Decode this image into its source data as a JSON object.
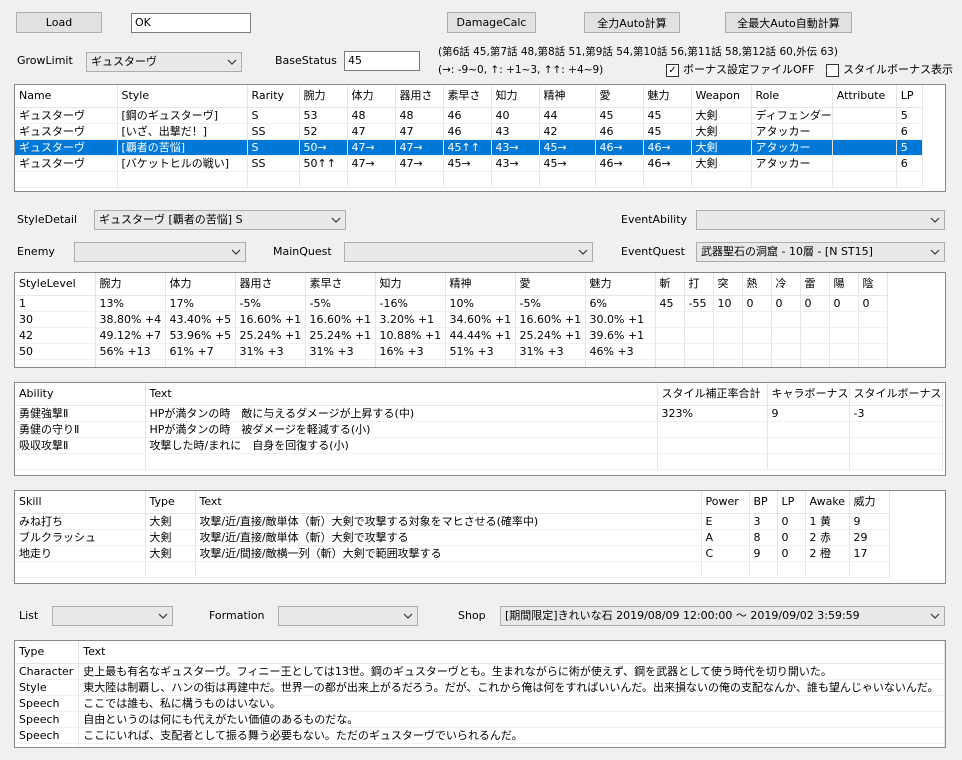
{
  "toolbar": {
    "load_label": "Load",
    "load_value": "OK",
    "damage_calc_label": "DamageCalc",
    "full_auto_label": "全力Auto計算",
    "max_auto_label": "全最大Auto自動計算"
  },
  "grow": {
    "label": "GrowLimit",
    "value": "ギュスターヴ",
    "base_status_label": "BaseStatus",
    "base_status_value": "45",
    "info_line1": "(第6話 45,第7話 48,第8話 51,第9話 54,第10話 56,第11話 58,第12話 60,外伝 63)",
    "info_line2": "(→: -9~0, ↑: +1~3, ↑↑: +4~9)",
    "bonus_file_off_label": "ボーナス設定ファイルOFF",
    "bonus_file_off_checked": "✓",
    "style_bonus_label": "スタイルボーナス表示",
    "style_bonus_checked": ""
  },
  "styles_table": {
    "headers": [
      "Name",
      "Style",
      "Rarity",
      "腕力",
      "体力",
      "器用さ",
      "素早さ",
      "知力",
      "精神",
      "愛",
      "魅力",
      "Weapon",
      "Role",
      "Attribute",
      "LP"
    ],
    "rows": [
      [
        "ギュスターヴ",
        "[鋼のギュスターヴ]",
        "S",
        "53",
        "48",
        "48",
        "46",
        "40",
        "44",
        "45",
        "45",
        "大剣",
        "ディフェンダー",
        "",
        "5"
      ],
      [
        "ギュスターヴ",
        "[いざ、出撃だ！]",
        "SS",
        "52",
        "47",
        "47",
        "46",
        "43",
        "42",
        "46",
        "45",
        "大剣",
        "アタッカー",
        "",
        "6"
      ],
      [
        "ギュスターヴ",
        "[覇者の苦悩]",
        "S",
        "50→",
        "47→",
        "47→",
        "45↑↑",
        "43→",
        "45→",
        "46→",
        "46→",
        "大剣",
        "アタッカー",
        "",
        "5"
      ],
      [
        "ギュスターヴ",
        "[バケットヒルの戦い]",
        "SS",
        "50↑↑",
        "47→",
        "47→",
        "45→",
        "43→",
        "45→",
        "46→",
        "46→",
        "大剣",
        "アタッカー",
        "",
        "6"
      ]
    ],
    "selected_row": 2
  },
  "filters": {
    "style_detail_label": "StyleDetail",
    "style_detail_value": "ギュスターヴ [覇者の苦悩] S",
    "event_ability_label": "EventAbility",
    "event_ability_value": "",
    "enemy_label": "Enemy",
    "enemy_value": "",
    "main_quest_label": "MainQuest",
    "main_quest_value": "",
    "event_quest_label": "EventQuest",
    "event_quest_value": "武器聖石の洞窟 - 10層 - [N ST15]"
  },
  "level_table": {
    "headers": [
      "StyleLevel",
      "腕力",
      "体力",
      "器用さ",
      "素早さ",
      "知力",
      "精神",
      "愛",
      "魅力",
      "斬",
      "打",
      "突",
      "熱",
      "冷",
      "雷",
      "陽",
      "陰"
    ],
    "rows": [
      [
        "1",
        "13%",
        "17%",
        "-5%",
        "-5%",
        "-16%",
        "10%",
        "-5%",
        "6%",
        "45",
        "-55",
        "10",
        "0",
        "0",
        "0",
        "0",
        "0"
      ],
      [
        "30",
        "38.80% +4",
        "43.40% +5",
        "16.60% +1",
        "16.60% +1",
        "3.20% +1",
        "34.60% +1",
        "16.60% +1",
        "30.0% +1",
        "",
        "",
        "",
        "",
        "",
        "",
        "",
        ""
      ],
      [
        "42",
        "49.12% +7",
        "53.96% +5",
        "25.24% +1",
        "25.24% +1",
        "10.88% +1",
        "44.44% +1",
        "25.24% +1",
        "39.6% +1",
        "",
        "",
        "",
        "",
        "",
        "",
        "",
        ""
      ],
      [
        "50",
        "56% +13",
        "61% +7",
        "31% +3",
        "31% +3",
        "16% +3",
        "51% +3",
        "31% +3",
        "46% +3",
        "",
        "",
        "",
        "",
        "",
        "",
        "",
        ""
      ]
    ]
  },
  "ability_table": {
    "headers": [
      "Ability",
      "Text",
      "スタイル補正率合計",
      "キャラボーナス",
      "スタイルボーナス"
    ],
    "rows": [
      [
        "勇健強撃Ⅱ",
        "HPが満タンの時　敵に与えるダメージが上昇する(中)",
        "323%",
        "9",
        "-3"
      ],
      [
        "勇健の守りⅡ",
        "HPが満タンの時　被ダメージを軽減する(小)",
        "",
        "",
        ""
      ],
      [
        "吸収攻撃Ⅱ",
        "攻撃した時/まれに　自身を回復する(小)",
        "",
        "",
        ""
      ]
    ]
  },
  "skill_table": {
    "headers": [
      "Skill",
      "Type",
      "Text",
      "Power",
      "BP",
      "LP",
      "Awake",
      "威力"
    ],
    "rows": [
      [
        "みね打ち",
        "大剣",
        "攻撃/近/直接/敵単体（斬）大剣で攻撃する対象をマヒさせる(確率中)",
        "E",
        "3",
        "0",
        "1 黄",
        "9"
      ],
      [
        "ブルクラッシュ",
        "大剣",
        "攻撃/近/直接/敵単体（斬）大剣で攻撃する",
        "A",
        "8",
        "0",
        "2 赤",
        "29"
      ],
      [
        "地走り",
        "大剣",
        "攻撃/近/間接/敵横一列（斬）大剣で範囲攻撃する",
        "C",
        "9",
        "0",
        "2 橙",
        "17"
      ]
    ]
  },
  "bottom": {
    "list_label": "List",
    "list_value": "",
    "formation_label": "Formation",
    "formation_value": "",
    "shop_label": "Shop",
    "shop_value": "[期間限定]きれいな石 2019/08/09 12:00:00 ～ 2019/09/02 3:59:59"
  },
  "text_table": {
    "headers": [
      "Type",
      "Text"
    ],
    "rows": [
      [
        "Character",
        "史上最も有名なギュスターヴ。フィニー王としては13世。鋼のギュスターヴとも。生まれながらに術が使えず、鋼を武器として使う時代を切り開いた。"
      ],
      [
        "Style",
        "東大陸は制覇し、ハンの街は再建中だ。世界一の都が出来上がるだろう。だが、これから俺は何をすればいいんだ。出来損ないの俺の支配なんか、誰も望んじゃいないんだ。"
      ],
      [
        "Speech",
        "ここでは誰も、私に構うものはいない。"
      ],
      [
        "Speech",
        "自由というのは何にも代えがたい価値のあるものだな。"
      ],
      [
        "Speech",
        "ここにいれば、支配者として振る舞う必要もない。ただのギュスターヴでいられるんだ。"
      ]
    ]
  }
}
